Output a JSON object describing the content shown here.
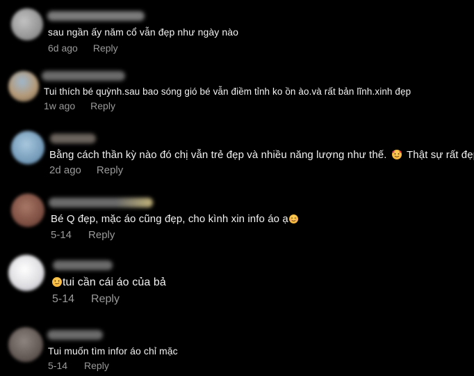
{
  "colors": {
    "background": "#000000",
    "text": "#f2f2f2",
    "meta": "#9a9a9a",
    "emoji_yellow": "#f5c242"
  },
  "comments": [
    {
      "text": "sau ngần ấy năm cổ vẫn đẹp như ngày nào",
      "time": "6d ago",
      "reply": "Reply",
      "avatar_color": "#a8a8a8"
    },
    {
      "text": "Tui thích bé quỳnh.sau bao sóng gió bé vẫn điềm tỉnh ko ồn ào.và rất bản lĩnh.xinh đẹp",
      "time": "1w ago",
      "reply": "Reply",
      "avatar_color": "#c8a57a"
    },
    {
      "text": "Bằng cách thần kỳ nào đó chị vẫn trẻ đẹp và nhiều năng lượng như thế.",
      "emoji_icon": "smiling-face-with-hearts-icon",
      "text_after": "Thật sự rất đẹp!",
      "time": "2d ago",
      "reply": "Reply",
      "avatar_color": "#7aa3c4"
    },
    {
      "text": "Bé Q đẹp, mặc áo cũng đẹp, cho kình xin info áo ạ",
      "emoji_icon": "smiling-face-icon",
      "time": "5-14",
      "reply": "Reply",
      "avatar_color": "#8a5a4a"
    },
    {
      "emoji_icon": "smirking-face-icon",
      "text": "tui cần cái áo của bả",
      "time": "5-14",
      "reply": "Reply",
      "avatar_color": "#e8e8ea"
    },
    {
      "text": "Tui muốn tìm infor áo chỉ mặc",
      "time": "5-14",
      "reply": "Reply",
      "avatar_color": "#6e6460"
    }
  ]
}
